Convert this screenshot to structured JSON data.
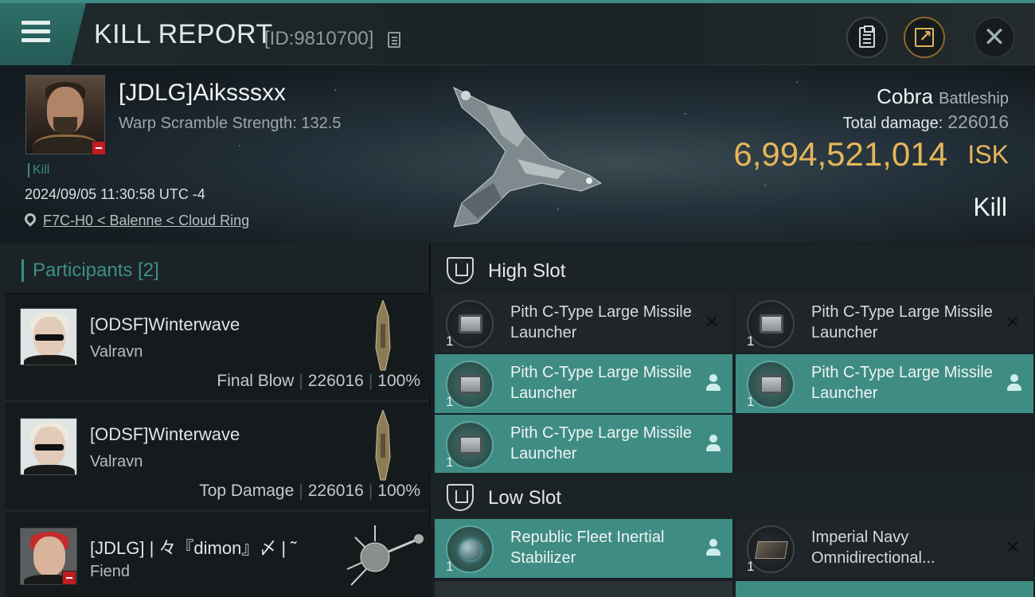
{
  "header": {
    "title": "KILL REPORT",
    "report_id": "[ID:9810700]"
  },
  "victim": {
    "name": "[JDLG]Aiksssxx",
    "warp_scramble": "Warp Scramble Strength: 132.5",
    "kill_tag": "Kill",
    "datetime": "2024/09/05 11:30:58 UTC -4",
    "location": "F7C-H0 < Balenne < Cloud Ring",
    "ship_name": "Cobra",
    "ship_class": "Battleship",
    "total_damage_label": "Total damage:",
    "total_damage_value": "226016",
    "isk_value": "6,994,521,014",
    "isk_unit": "ISK",
    "result": "Kill"
  },
  "participants": {
    "title": "Participants [2]",
    "rows": [
      {
        "name": "[ODSF]Winterwave",
        "ship": "Valravn",
        "role": "Final Blow",
        "damage": "226016",
        "percent": "100%"
      },
      {
        "name": "[ODSF]Winterwave",
        "ship": "Valravn",
        "role": "Top Damage",
        "damage": "226016",
        "percent": "100%"
      },
      {
        "name": "[JDLG] | 々『dimon』〆 | ˜",
        "ship": "Fiend"
      }
    ]
  },
  "slots": {
    "high_label": "High Slot",
    "low_label": "Low Slot",
    "high": [
      {
        "name": "Pith C-Type Large Missile Launcher",
        "qty": "1",
        "state": "destroyed"
      },
      {
        "name": "Pith C-Type Large Missile Launcher",
        "qty": "1",
        "state": "destroyed"
      },
      {
        "name": "Pith C-Type Large Missile Launcher",
        "qty": "1",
        "state": "dropped"
      },
      {
        "name": "Pith C-Type Large Missile Launcher",
        "qty": "1",
        "state": "dropped"
      },
      {
        "name": "Pith C-Type Large Missile Launcher",
        "qty": "1",
        "state": "dropped"
      }
    ],
    "low": [
      {
        "name": "Republic Fleet Inertial Stabilizer",
        "qty": "1",
        "state": "dropped"
      },
      {
        "name": "Imperial Navy Omnidirectional...",
        "qty": "1",
        "state": "destroyed"
      }
    ]
  },
  "icons": {
    "menu": "menu-icon",
    "copy": "copy-icon",
    "clipboard": "clipboard-icon",
    "share": "share-icon",
    "close": "close-icon",
    "location": "location-pin-icon",
    "slot": "slot-icon",
    "destroyed": "x-icon",
    "dropped": "person-icon"
  },
  "colors": {
    "accent": "#3a8f88",
    "isk": "#e6b659",
    "owned_bg": "#3f8c84",
    "alert": "#c01c22"
  }
}
